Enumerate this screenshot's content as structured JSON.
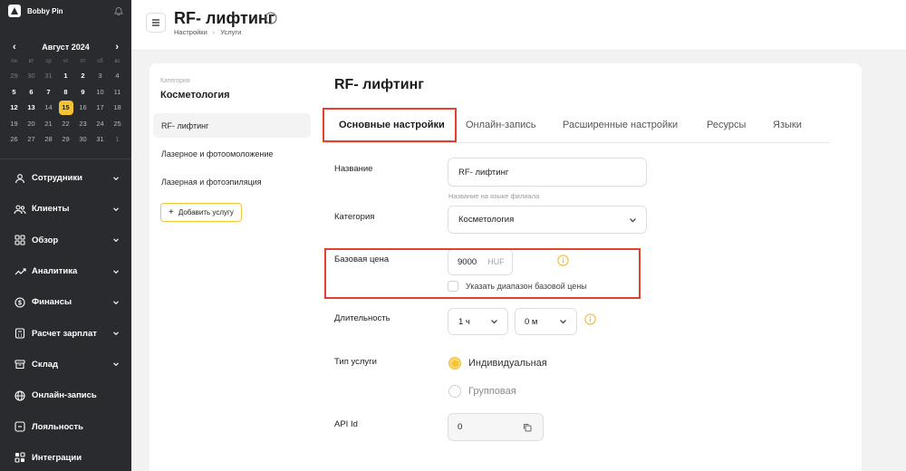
{
  "sidebar": {
    "brand": "Bobby Pin",
    "calendar": {
      "month": "Август 2024",
      "weekdays": [
        "пн",
        "вт",
        "ср",
        "чт",
        "пт",
        "сб",
        "вс"
      ],
      "days": [
        [
          "29",
          "30",
          "31",
          "1",
          "2",
          "3",
          "4"
        ],
        [
          "5",
          "6",
          "7",
          "8",
          "9",
          "10",
          "11"
        ],
        [
          "12",
          "13",
          "14",
          "15",
          "16",
          "17",
          "18"
        ],
        [
          "19",
          "20",
          "21",
          "22",
          "23",
          "24",
          "25"
        ],
        [
          "26",
          "27",
          "28",
          "29",
          "30",
          "31",
          "1"
        ]
      ],
      "today": "15"
    },
    "nav": [
      {
        "label": "Сотрудники",
        "icon": "user-icon",
        "has_submenu": true
      },
      {
        "label": "Клиенты",
        "icon": "users-icon",
        "has_submenu": true
      },
      {
        "label": "Обзор",
        "icon": "grid-icon",
        "has_submenu": true
      },
      {
        "label": "Аналитика",
        "icon": "chart-icon",
        "has_submenu": true
      },
      {
        "label": "Финансы",
        "icon": "dollar-icon",
        "has_submenu": true
      },
      {
        "label": "Расчет зарплат",
        "icon": "calculator-icon",
        "has_submenu": true
      },
      {
        "label": "Склад",
        "icon": "box-icon",
        "has_submenu": true
      },
      {
        "label": "Онлайн-запись",
        "icon": "globe-icon",
        "has_submenu": false
      },
      {
        "label": "Лояльность",
        "icon": "ticket-icon",
        "has_submenu": false
      },
      {
        "label": "Интеграции",
        "icon": "plug-icon",
        "has_submenu": false
      }
    ]
  },
  "header": {
    "title": "RF- лифтинг",
    "breadcrumb": [
      "Настройки",
      "Услуги"
    ]
  },
  "category": {
    "caption": "Категория",
    "name": "Косметология",
    "services": [
      "RF- лифтинг",
      "Лазерное и фотоомоложение",
      "Лазерная и фотоэпиляция"
    ],
    "active_index": 0,
    "add_label": "Добавить услугу"
  },
  "form": {
    "title": "RF- лифтинг",
    "tabs": [
      "Основные настройки",
      "Онлайн-запись",
      "Расширенные настройки",
      "Ресурсы",
      "Языки"
    ],
    "active_tab": 0,
    "name_label": "Название",
    "name_value": "RF- лифтинг",
    "name_hint": "Название на языке филиала",
    "category_label": "Категория",
    "category_value": "Косметология",
    "price_label": "Базовая цена",
    "price_value": "9000",
    "price_unit": "HUF",
    "price_range_label": "Указать диапазон базовой цены",
    "price_range_checked": false,
    "duration_label": "Длительность",
    "duration_hours": "1 ч",
    "duration_minutes": "0 м",
    "type_label": "Тип услуги",
    "type_options": [
      "Индивидуальная",
      "Групповая"
    ],
    "type_selected": 0,
    "api_label": "API Id",
    "api_value": "0"
  },
  "colors": {
    "accent": "#f5c232",
    "sidebar_bg": "#2a2b2e",
    "highlight": "#e2412f"
  }
}
